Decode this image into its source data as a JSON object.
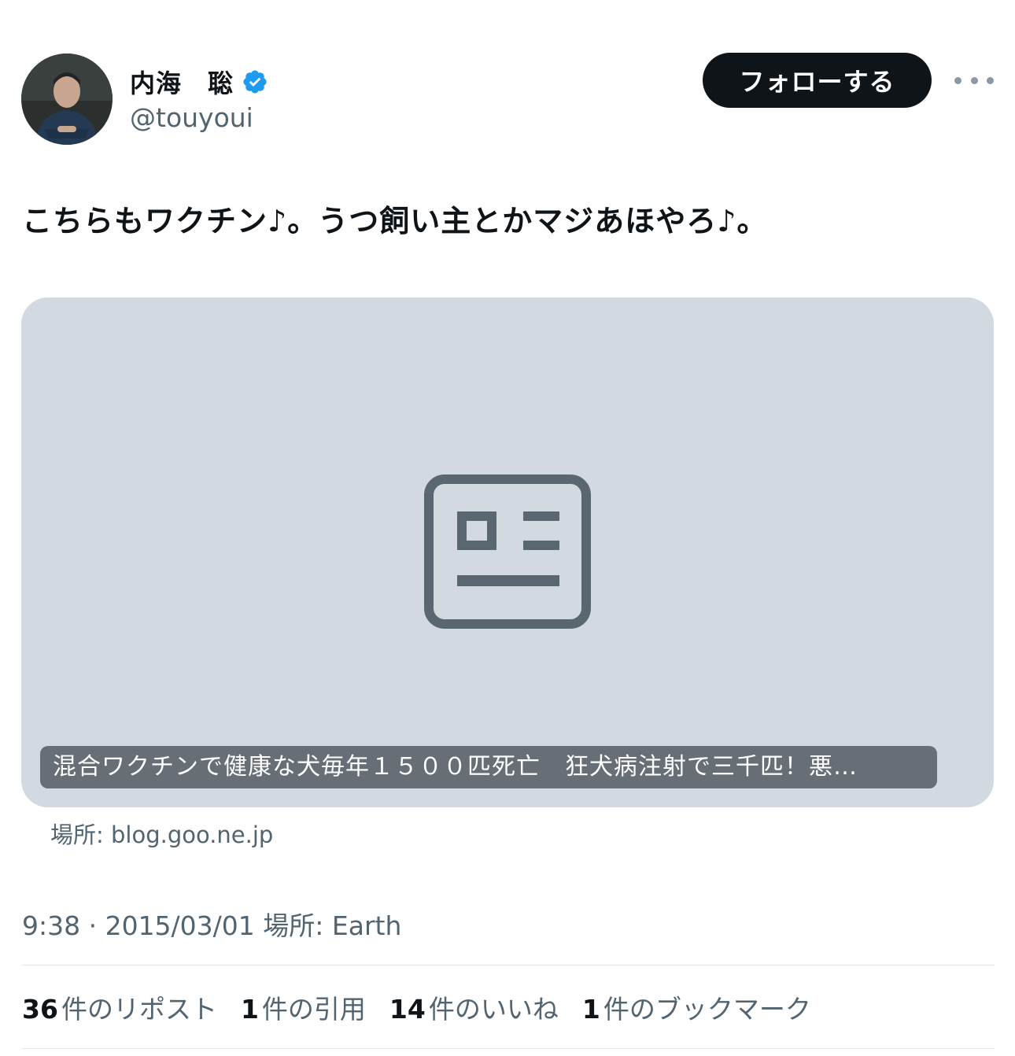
{
  "author": {
    "name": "内海　聡",
    "handle": "@touyoui",
    "verified": true,
    "avatar_icon": "profile-photo"
  },
  "actions": {
    "follow_label": "フォローする",
    "more_icon": "more-dots-icon"
  },
  "tweet": {
    "text": "こちらもワクチン♪。うつ飼い主とかマジあほやろ♪。"
  },
  "link_card": {
    "title": "混合ワクチンで健康な犬毎年１５００匹死亡　狂犬病注射で三千匹！悪…",
    "domain": "場所: blog.goo.ne.jp",
    "icon": "article-icon"
  },
  "meta": {
    "text": "9:38 · 2015/03/01  場所: Earth"
  },
  "stats": {
    "reposts": {
      "count": "36",
      "label": "件のリポスト"
    },
    "quotes": {
      "count": "1",
      "label": "件の引用"
    },
    "likes": {
      "count": "14",
      "label": "件のいいね"
    },
    "bookmarks": {
      "count": "1",
      "label": "件のブックマーク"
    }
  },
  "colors": {
    "text": "#0f1419",
    "secondary": "#536471",
    "verified": "#1d9bf0",
    "card_bg": "#d3d9e0",
    "card_title_bg": "#676e75"
  }
}
